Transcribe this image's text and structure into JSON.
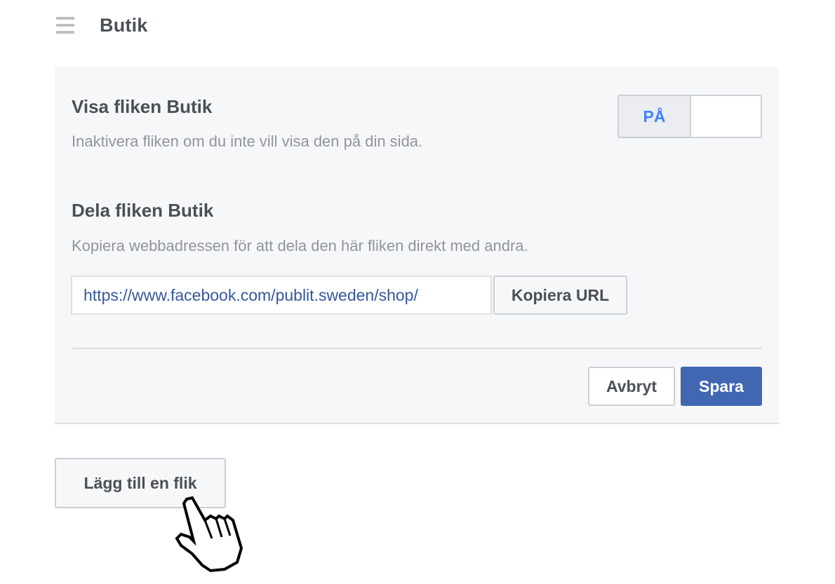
{
  "header": {
    "menu_icon": "hamburger-menu-icon",
    "title": "Butik"
  },
  "show_tab": {
    "title": "Visa fliken Butik",
    "description": "Inaktivera fliken om du inte vill visa den på din sida.",
    "toggle_label": "PÅ",
    "toggle_state": "on"
  },
  "share_tab": {
    "title": "Dela fliken Butik",
    "description": "Kopiera webbadressen för att dela den här fliken direkt med andra.",
    "url": "https://www.facebook.com/publit.sweden/shop/",
    "copy_label": "Kopiera URL"
  },
  "actions": {
    "cancel_label": "Avbryt",
    "save_label": "Spara"
  },
  "add_tab": {
    "label": "Lägg till en flik"
  },
  "cursor": {
    "icon": "hand-pointer-cursor-icon"
  },
  "colors": {
    "accent_blue": "#4267b2",
    "toggle_blue": "#4080ff",
    "link_blue": "#365899",
    "panel_bg": "#f6f7f9",
    "text": "#4b4f56",
    "muted_text": "#90949c"
  }
}
